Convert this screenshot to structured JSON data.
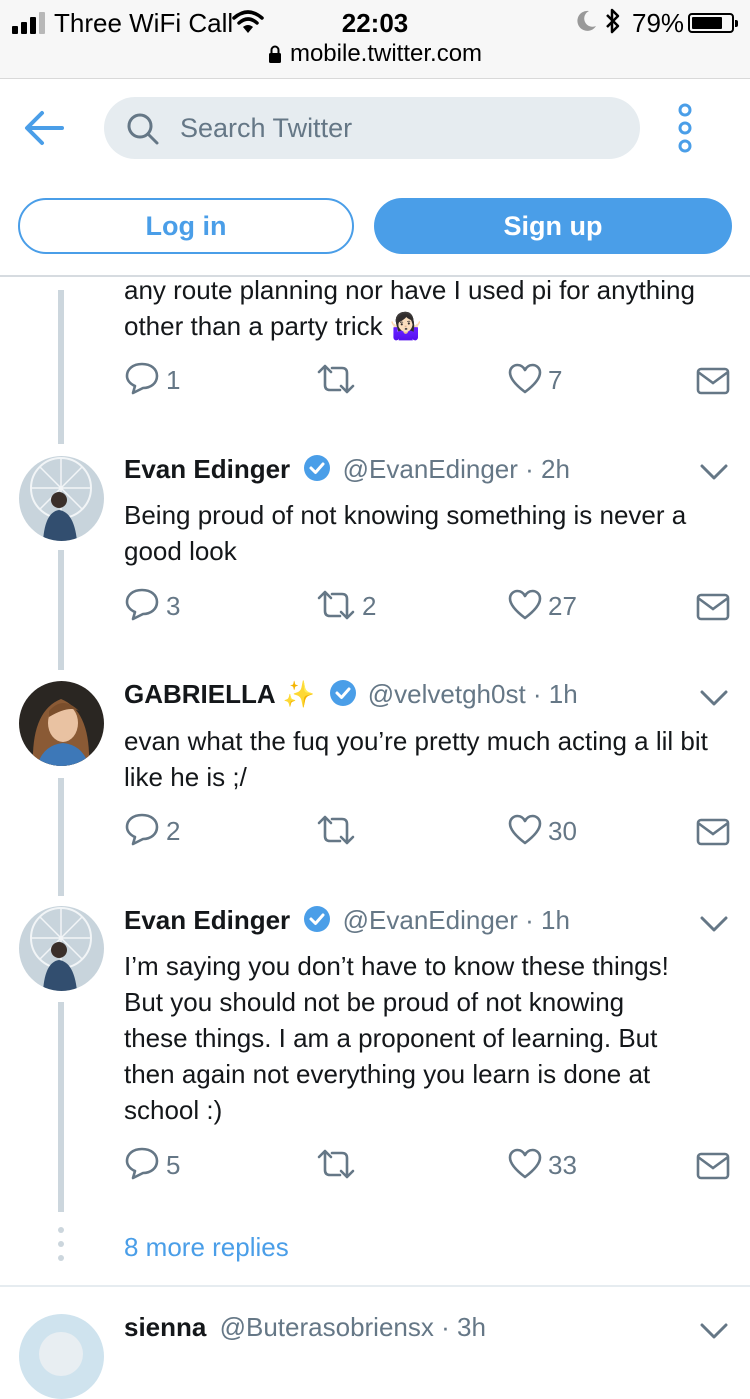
{
  "status_bar": {
    "carrier": "Three WiFi Call",
    "time": "22:03",
    "battery": "79%",
    "battery_level": 0.79,
    "url": "mobile.twitter.com"
  },
  "header": {
    "search_placeholder": "Search Twitter",
    "login_label": "Log in",
    "signup_label": "Sign up"
  },
  "colors": {
    "accent": "#4a9ee8",
    "muted": "#657786",
    "line": "#ccd6dd"
  },
  "tweets": [
    {
      "text": "any route planning nor have I used pi for anything other than a party trick 🤷🏻‍♀️",
      "replies": "1",
      "retweets": "",
      "likes": "7"
    },
    {
      "name": "Evan Edinger",
      "handle": "@EvanEdinger",
      "time": "2h",
      "text": "Being proud of not knowing something is never a good look",
      "replies": "3",
      "retweets": "2",
      "likes": "27"
    },
    {
      "name": "GABRIELLA",
      "name_emoji": "✨",
      "handle": "@velvetgh0st",
      "time": "1h",
      "text": "evan what the fuq you’re pretty much acting a lil bit like he is ;/",
      "replies": "2",
      "retweets": "",
      "likes": "30"
    },
    {
      "name": "Evan Edinger",
      "handle": "@EvanEdinger",
      "time": "1h",
      "text": "I’m saying you don’t have to know these things! But you should not be proud of not knowing these things. I am a proponent of learning. But then again not everything you learn is done at school :)",
      "replies": "5",
      "retweets": "",
      "likes": "33"
    }
  ],
  "more_replies": "8 more replies",
  "next_tweet": {
    "name": "sienna",
    "handle": "@Buterasobriensx",
    "time": "3h"
  }
}
